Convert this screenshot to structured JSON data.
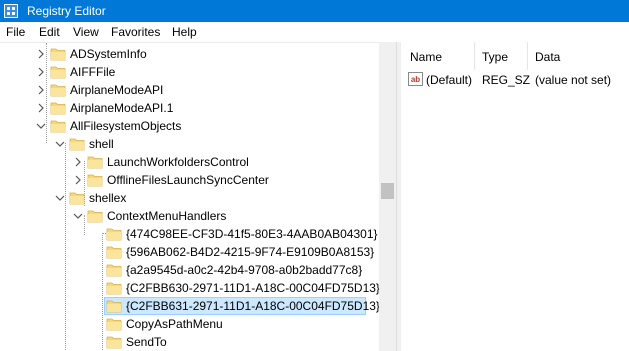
{
  "window": {
    "title": "Registry Editor"
  },
  "menu": [
    "File",
    "Edit",
    "View",
    "Favorites",
    "Help"
  ],
  "tree": [
    {
      "label": "ADSystemInfo",
      "expander": "collapsed"
    },
    {
      "label": "AIFFFile",
      "expander": "collapsed"
    },
    {
      "label": "AirplaneModeAPI",
      "expander": "collapsed"
    },
    {
      "label": "AirplaneModeAPI.1",
      "expander": "collapsed"
    },
    {
      "label": "AllFilesystemObjects",
      "expander": "expanded"
    },
    {
      "label": "shell",
      "expander": "expanded"
    },
    {
      "label": "LaunchWorkfoldersControl",
      "expander": "collapsed"
    },
    {
      "label": "OfflineFilesLaunchSyncCenter",
      "expander": "collapsed"
    },
    {
      "label": "shellex",
      "expander": "expanded"
    },
    {
      "label": "ContextMenuHandlers",
      "expander": "expanded"
    },
    {
      "label": "{474C98EE-CF3D-41f5-80E3-4AAB0AB04301}",
      "expander": "none"
    },
    {
      "label": "{596AB062-B4D2-4215-9F74-E9109B0A8153}",
      "expander": "none"
    },
    {
      "label": "{a2a9545d-a0c2-42b4-9708-a0b2badd77c8}",
      "expander": "none"
    },
    {
      "label": "{C2FBB630-2971-11D1-A18C-00C04FD75D13}",
      "expander": "none"
    },
    {
      "label": "{C2FBB631-2971-11D1-A18C-00C04FD75D13}",
      "expander": "none",
      "selected": true
    },
    {
      "label": "CopyAsPathMenu",
      "expander": "none"
    },
    {
      "label": "SendTo",
      "expander": "none"
    }
  ],
  "list": {
    "columns": [
      "Name",
      "Type",
      "Data"
    ],
    "rows": [
      {
        "name": "(Default)",
        "type": "REG_SZ",
        "data": "(value not set)",
        "icon": "string-value-icon"
      }
    ]
  },
  "colors": {
    "titlebar": "#0078d7",
    "folder": "#f8d775",
    "selection": "#cce8ff",
    "value_icon": "#c0392b"
  }
}
